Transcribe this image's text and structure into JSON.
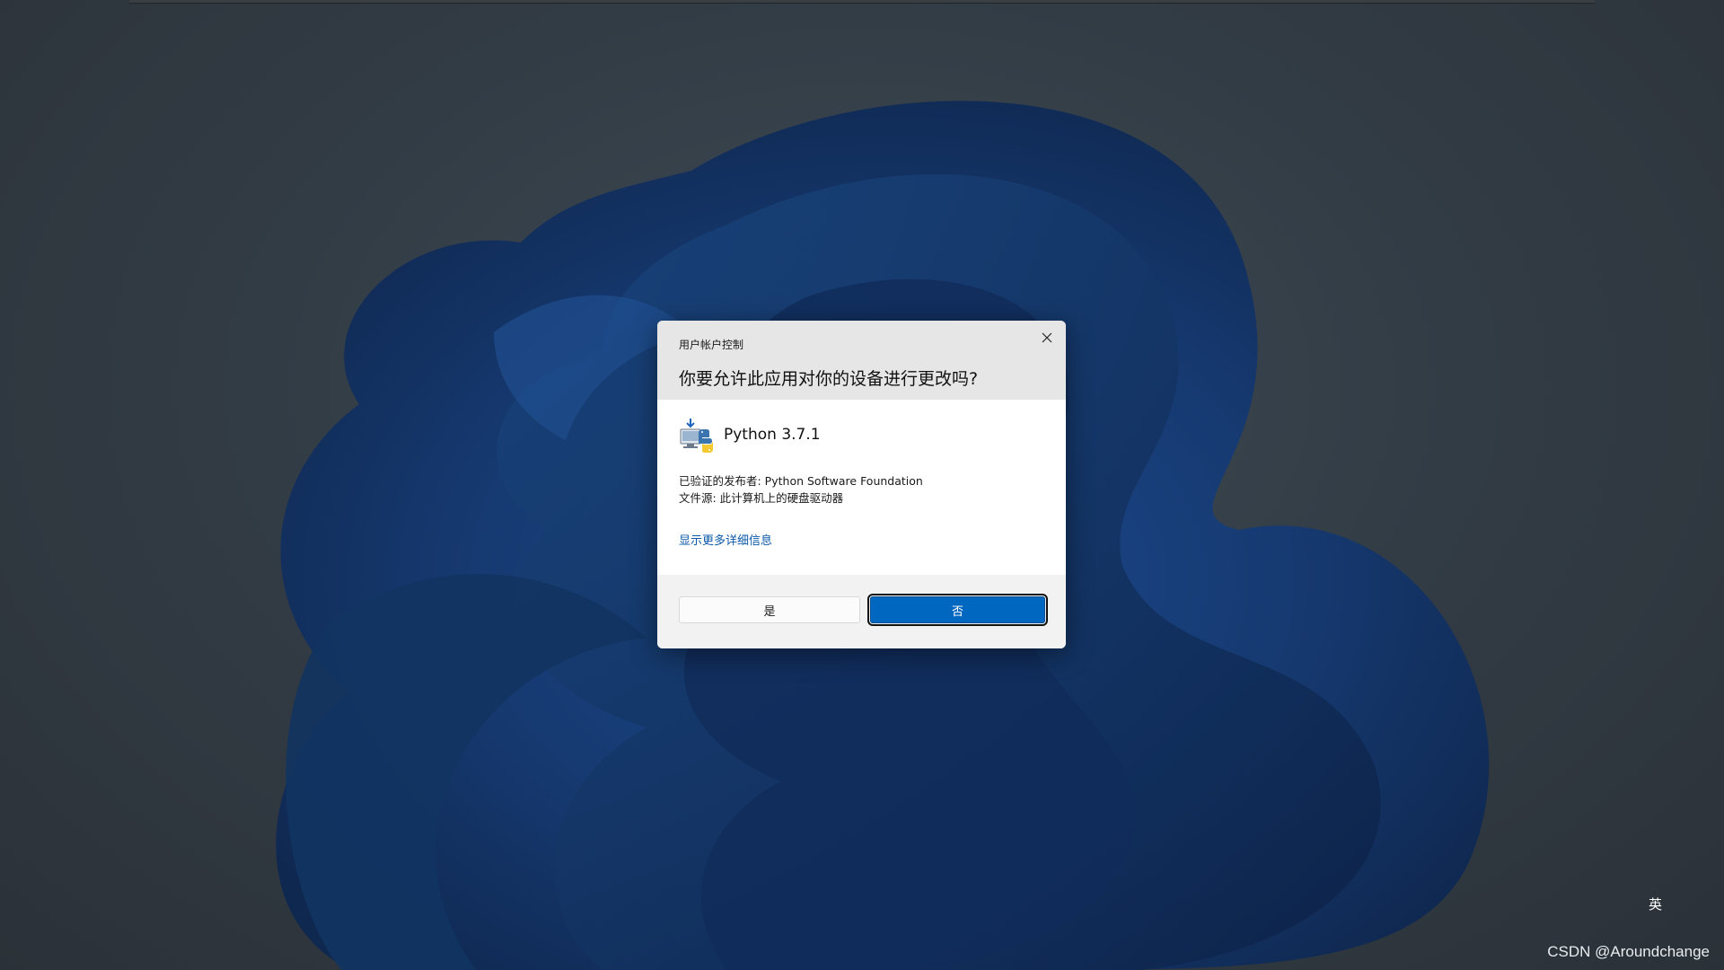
{
  "dialog": {
    "title": "用户帐户控制",
    "question": "你要允许此应用对你的设备进行更改吗?",
    "app_name": "Python 3.7.1",
    "publisher_line": "已验证的发布者: Python Software Foundation",
    "source_line": "文件源: 此计算机上的硬盘驱动器",
    "details_link": "显示更多详细信息",
    "yes_label": "是",
    "no_label": "否",
    "accent_color": "#0067c0",
    "link_color": "#0b58a8",
    "icons": {
      "close": "close-icon",
      "app": "python-installer-icon"
    }
  },
  "desktop": {
    "ime_indicator": "英",
    "watermark": "CSDN @Aroundchange"
  }
}
